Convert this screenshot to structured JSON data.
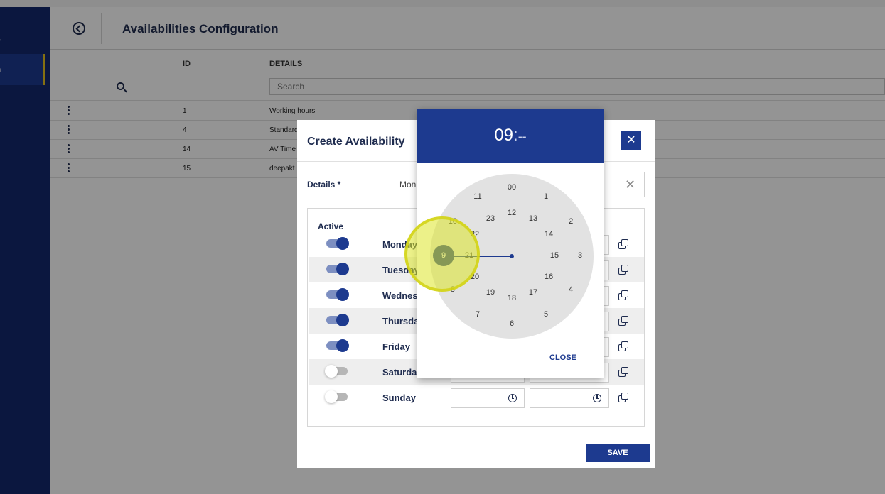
{
  "sidebar": {
    "items": [
      {
        "label": "ter"
      },
      {
        "label": "on"
      }
    ]
  },
  "header": {
    "title": "Availabilities Configuration"
  },
  "table": {
    "columns": {
      "id": "ID",
      "details": "DETAILS"
    },
    "search_placeholder": "Search",
    "rows": [
      {
        "id": "1",
        "details": "Working hours"
      },
      {
        "id": "4",
        "details": "Standard"
      },
      {
        "id": "14",
        "details": "AV Time"
      },
      {
        "id": "15",
        "details": "deepakt"
      }
    ]
  },
  "modal": {
    "title": "Create Availability",
    "close_label": "✕",
    "details_label": "Details *",
    "details_value": "Mon",
    "clear_label": "✕",
    "active_label": "Active",
    "save_label": "SAVE",
    "days": [
      {
        "name": "Monday",
        "active": true
      },
      {
        "name": "Tuesday",
        "active": true
      },
      {
        "name": "Wednesday",
        "active": true
      },
      {
        "name": "Thursday",
        "active": true
      },
      {
        "name": "Friday",
        "active": true
      },
      {
        "name": "Saturday",
        "active": false
      },
      {
        "name": "Sunday",
        "active": false
      }
    ]
  },
  "time_picker": {
    "hours": "09",
    "separator": ":",
    "minutes": "--",
    "selected": "9",
    "close_label": "CLOSE",
    "outer_numbers": [
      "00",
      "1",
      "2",
      "3",
      "4",
      "5",
      "6",
      "7",
      "8",
      "9",
      "10",
      "11"
    ],
    "inner_numbers": [
      "12",
      "13",
      "14",
      "15",
      "16",
      "17",
      "18",
      "19",
      "20",
      "21",
      "22",
      "23"
    ]
  },
  "colors": {
    "sidebar": "#13286d",
    "accent": "#1d3a8f",
    "click_highlight": "#dde628"
  }
}
